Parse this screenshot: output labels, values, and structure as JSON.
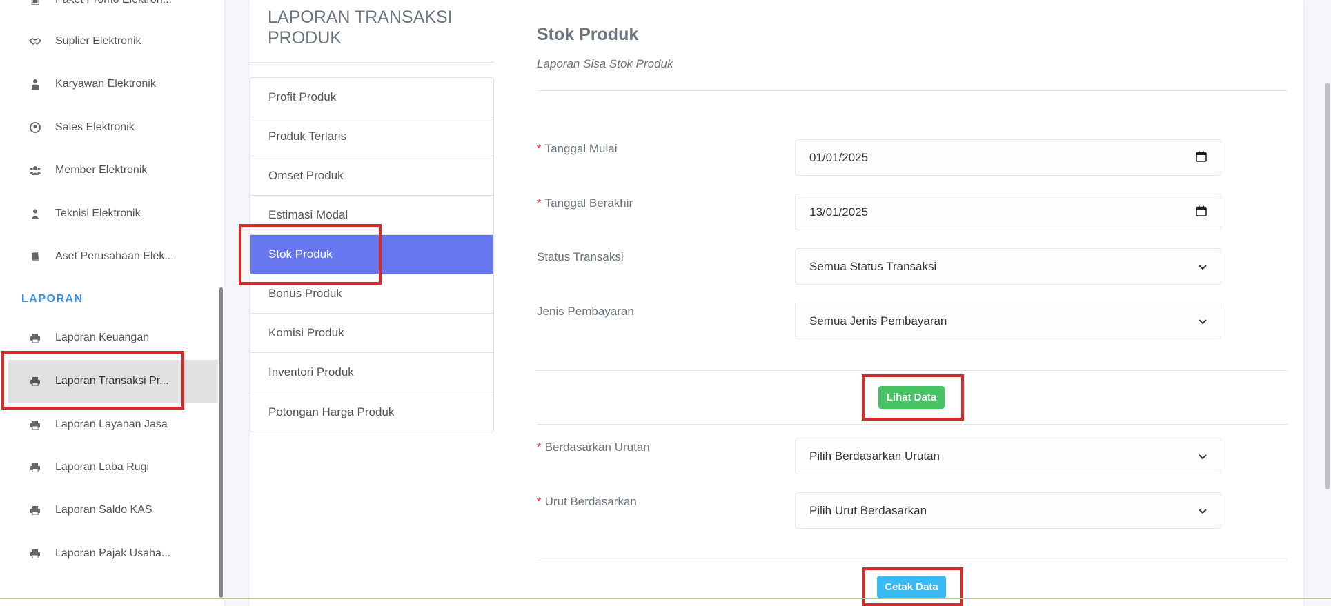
{
  "sidebar": {
    "items_top": [
      {
        "label": "Paket Promo Elektron...",
        "icon": "box-icon"
      },
      {
        "label": "Suplier Elektronik",
        "icon": "handshake-icon"
      },
      {
        "label": "Karyawan Elektronik",
        "icon": "user-tie-icon"
      },
      {
        "label": "Sales Elektronik",
        "icon": "user-circle-icon"
      },
      {
        "label": "Member Elektronik",
        "icon": "users-icon"
      },
      {
        "label": "Teknisi Elektronik",
        "icon": "user-icon"
      },
      {
        "label": "Aset Perusahaan Elek...",
        "icon": "book-icon"
      }
    ],
    "header": "LAPORAN",
    "items_laporan": [
      {
        "label": "Laporan Keuangan",
        "icon": "printer-icon"
      },
      {
        "label": "Laporan Transaksi Pr...",
        "icon": "printer-icon",
        "active": true
      },
      {
        "label": "Laporan Layanan Jasa",
        "icon": "printer-icon"
      },
      {
        "label": "Laporan Laba Rugi",
        "icon": "printer-icon"
      },
      {
        "label": "Laporan Saldo KAS",
        "icon": "printer-icon"
      },
      {
        "label": "Laporan Pajak Usaha...",
        "icon": "printer-icon"
      }
    ]
  },
  "report_menu": {
    "title": "LAPORAN TRANSAKSI PRODUK",
    "items": [
      "Profit Produk",
      "Produk Terlaris",
      "Omset Produk",
      "Estimasi Modal",
      "Stok Produk",
      "Bonus Produk",
      "Komisi Produk",
      "Inventori Produk",
      "Potongan Harga Produk"
    ],
    "active_item": "Stok Produk"
  },
  "form": {
    "title": "Stok Produk",
    "subtitle": "Laporan Sisa Stok Produk",
    "fields": {
      "start_date": {
        "label": "Tanggal Mulai",
        "value": "01/01/2025",
        "required": true
      },
      "end_date": {
        "label": "Tanggal Berakhir",
        "value": "13/01/2025",
        "required": true
      },
      "status": {
        "label": "Status Transaksi",
        "value": "Semua Status Transaksi",
        "required": false
      },
      "payment": {
        "label": "Jenis Pembayaran",
        "value": "Semua Jenis Pembayaran",
        "required": false
      },
      "sort_by": {
        "label": "Berdasarkan Urutan",
        "value": "Pilih Berdasarkan Urutan",
        "required": true
      },
      "order": {
        "label": "Urut Berdasarkan",
        "value": "Pilih Urut Berdasarkan",
        "required": true
      }
    },
    "view_button": "Lihat Data",
    "print_button": "Cetak Data",
    "required_mark": "*"
  },
  "colors": {
    "accent": "#6777ef",
    "success": "#47c363",
    "info": "#3abaf4",
    "highlight": "#d42a2a",
    "sidebar_header": "#3a8fe0"
  }
}
